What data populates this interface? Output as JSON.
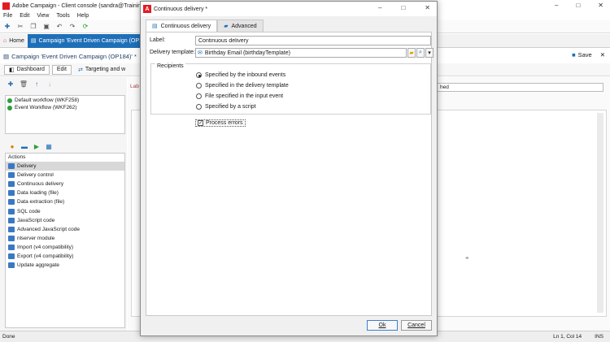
{
  "main_window": {
    "title": "Adobe Campaign - Client console (sandra@Training",
    "menu": [
      "File",
      "Edit",
      "View",
      "Tools",
      "Help"
    ],
    "tabs": {
      "home": "Home",
      "campaign": "Campaign 'Event Driven Campaign (OP18"
    },
    "campaign_header": "Campaign 'Event Driven Campaign (OP184)' *",
    "save_label": "Save",
    "subtabs": {
      "dashboard": "Dashboard",
      "edit": "Edit",
      "targeting": "Targeting and w"
    },
    "workflows": [
      {
        "label": "Default workflow (WKF258)",
        "color": "#2e9e3a"
      },
      {
        "label": "Event Workflow (WKF262)",
        "color": "#2e9e3a"
      }
    ],
    "actions_title": "Actions",
    "actions": [
      "Delivery",
      "Delivery control",
      "Continuous delivery",
      "Data loading (file)",
      "Data extraction (file)",
      "SQL code",
      "JavaScript code",
      "Advanced JavaScript code",
      "nlserver module",
      "Import (v4 compatibility)",
      "Export (v4 compatibility)",
      "Update aggregate"
    ],
    "right_label": "Lab",
    "right_field_value": "hed",
    "status": {
      "left": "Done",
      "position": "Ln 1, Col 14",
      "mode": "INS"
    }
  },
  "dialog": {
    "title": "Continuous delivery *",
    "tabs": {
      "continuous": "Continuous delivery",
      "advanced": "Advanced"
    },
    "label_caption": "Label:",
    "label_value": "Continuous delivery",
    "template_caption": "Delivery template:",
    "template_value": "Birthday Email (birthdayTemplate)",
    "recipients_title": "Recipients",
    "recipient_options": [
      "Specified by the inbound events",
      "Specified in the delivery template",
      "File specified in the input event",
      "Specified by a script"
    ],
    "process_errors": "Process errors",
    "ok": "Ok",
    "cancel": "Cancel"
  },
  "colors": {
    "accent": "#1e6fb8",
    "brand": "#e31b23"
  }
}
